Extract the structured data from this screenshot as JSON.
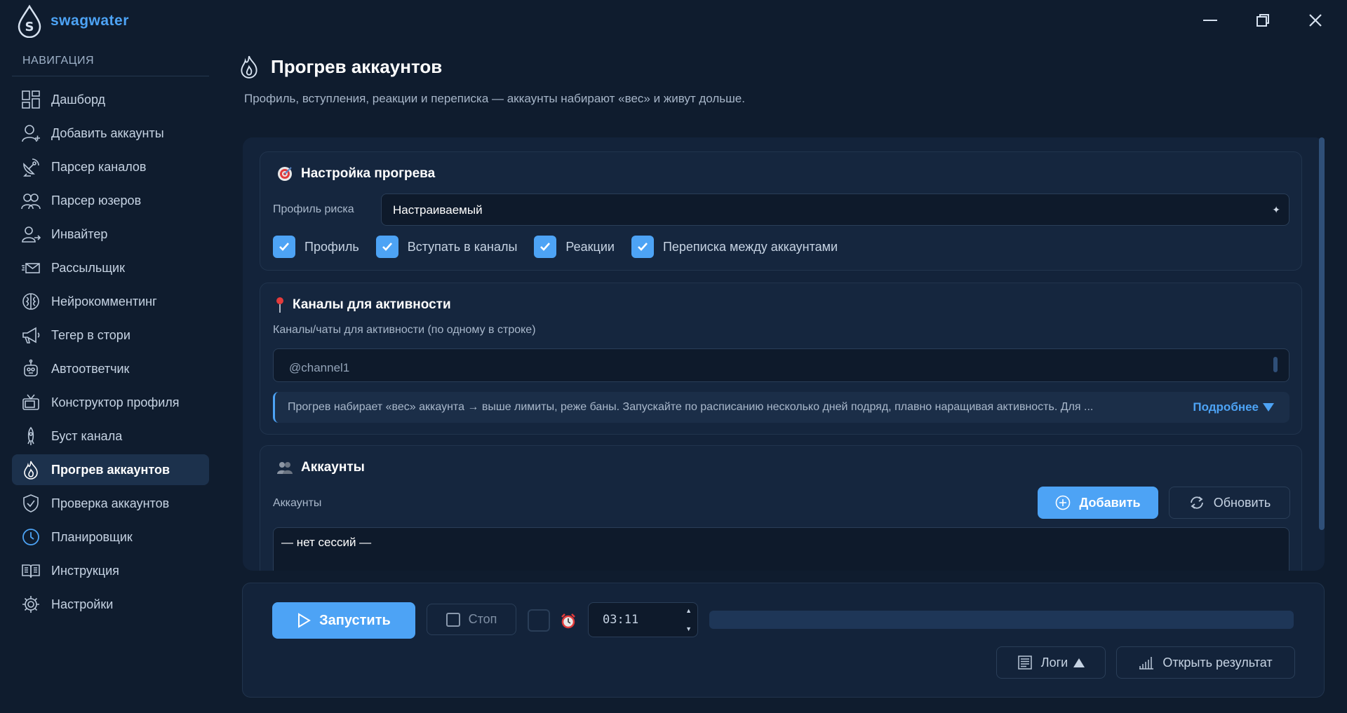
{
  "app": {
    "name": "swagwater"
  },
  "colors": {
    "accent": "#4da3f5",
    "background": "#0f1c2e",
    "card": "#15263e",
    "active_nav": "#1c314c"
  },
  "sidebar": {
    "title": "НАВИГАЦИЯ",
    "items": [
      {
        "label": "Дашборд",
        "icon": "dashboard-icon"
      },
      {
        "label": "Добавить аккаунты",
        "icon": "add-user-icon"
      },
      {
        "label": "Парсер каналов",
        "icon": "satellite-icon"
      },
      {
        "label": "Парсер юзеров",
        "icon": "users-icon"
      },
      {
        "label": "Инвайтер",
        "icon": "invite-user-icon"
      },
      {
        "label": "Рассыльщик",
        "icon": "mail-icon"
      },
      {
        "label": "Нейрокомментинг",
        "icon": "brain-icon"
      },
      {
        "label": "Тегер в стори",
        "icon": "megaphone-icon"
      },
      {
        "label": "Автоответчик",
        "icon": "robot-icon"
      },
      {
        "label": "Конструктор профиля",
        "icon": "tv-icon"
      },
      {
        "label": "Буст канала",
        "icon": "rocket-icon"
      },
      {
        "label": "Прогрев аккаунтов",
        "icon": "flame-icon",
        "active": true
      },
      {
        "label": "Проверка аккаунтов",
        "icon": "shield-check-icon"
      },
      {
        "label": "Планировщик",
        "icon": "clock-icon"
      },
      {
        "label": "Инструкция",
        "icon": "book-icon"
      },
      {
        "label": "Настройки",
        "icon": "gear-icon"
      }
    ]
  },
  "page": {
    "title": "Прогрев аккаунтов",
    "subtitle": "Профиль, вступления, реакции и переписка — аккаунты набирают «вес» и живут дольше."
  },
  "settings_card": {
    "title": "Настройка прогрева",
    "risk_label": "Профиль риска",
    "risk_value": "Настраиваемый",
    "checkboxes": [
      {
        "label": "Профиль",
        "checked": true
      },
      {
        "label": "Вступать в каналы",
        "checked": true
      },
      {
        "label": "Реакции",
        "checked": true
      },
      {
        "label": "Переписка между аккаунтами",
        "checked": true
      }
    ]
  },
  "channels_card": {
    "title": "Каналы для активности",
    "field_label": "Каналы/чаты для активности (по одному в строке)",
    "placeholder": "@channel1",
    "hint": "Прогрев набирает «вес» аккаунта → выше лимиты, реже баны. Запускайте по расписанию несколько дней подряд, плавно наращивая активность. Для ...",
    "more_label": "Подробнее"
  },
  "accounts_card": {
    "title": "Аккаунты",
    "label": "Аккаунты",
    "add_label": "Добавить",
    "refresh_label": "Обновить",
    "empty_text": "— нет сессий —"
  },
  "bottom": {
    "start_label": "Запустить",
    "stop_label": "Стоп",
    "schedule_checked": false,
    "time_value": "03:11",
    "progress": 0,
    "logs_label": "Логи",
    "result_label": "Открыть результат"
  }
}
